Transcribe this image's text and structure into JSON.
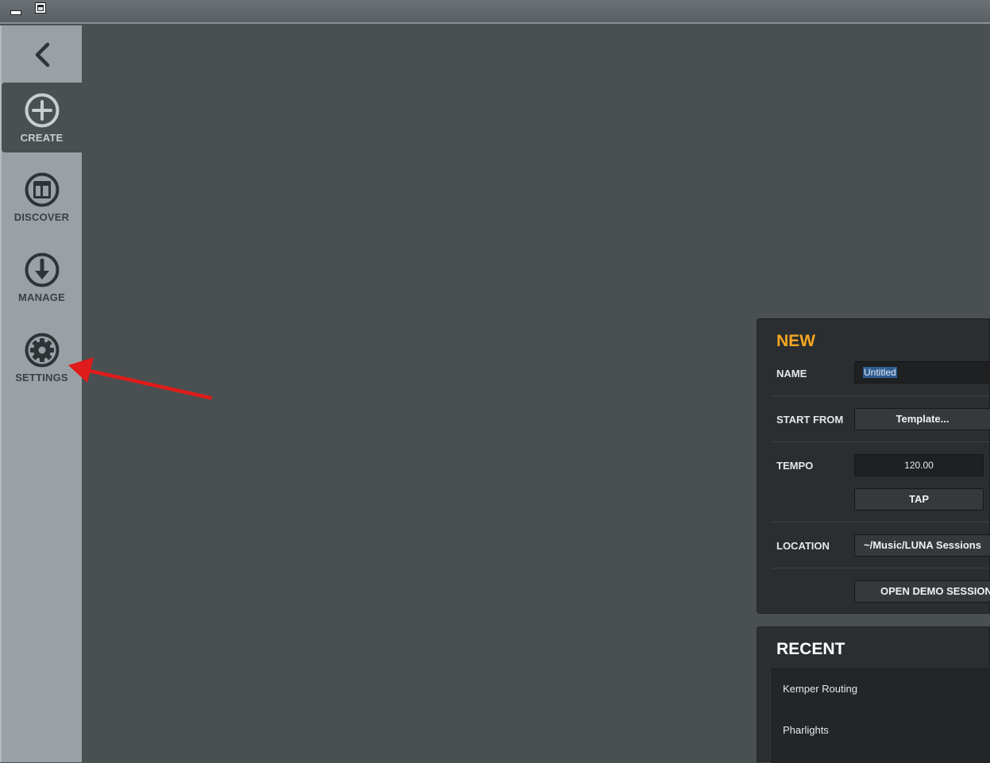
{
  "titlebar": {
    "minimize_icon": "minimize-icon",
    "maximize_icon": "maximize-icon"
  },
  "sidebar": {
    "back_icon": "chevron-left-icon",
    "items": [
      {
        "label": "CREATE",
        "icon": "plus-circle-icon",
        "active": true
      },
      {
        "label": "DISCOVER",
        "icon": "layout-circle-icon",
        "active": false
      },
      {
        "label": "MANAGE",
        "icon": "download-circle-icon",
        "active": false
      },
      {
        "label": "SETTINGS",
        "icon": "gear-icon",
        "active": false
      }
    ]
  },
  "new_panel": {
    "title": "NEW",
    "name_label": "NAME",
    "name_value": "Untitled",
    "start_from_label": "START FROM",
    "template_button": "Template...",
    "tempo_label": "TEMPO",
    "tempo_value": "120.00",
    "tap_button": "TAP",
    "location_label": "LOCATION",
    "location_button": "~/Music/LUNA Sessions",
    "open_demo_button": "OPEN DEMO SESSION"
  },
  "recent_panel": {
    "title": "RECENT",
    "items": [
      "Kemper Routing",
      "Pharlights"
    ]
  },
  "colors": {
    "accent": "#f5a623",
    "sidebar_bg": "#9aa1a6",
    "main_bg": "#4a5052",
    "panel_bg": "#2b2e30",
    "annotation_arrow": "#e01b1b"
  }
}
